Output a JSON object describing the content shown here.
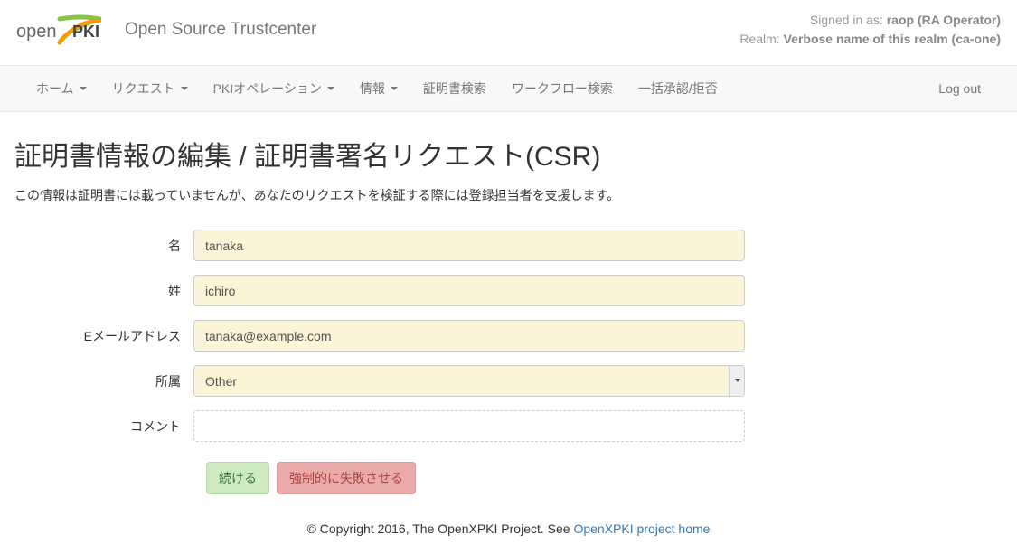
{
  "header": {
    "logo_text_open": "open",
    "logo_text_pki": "PKI",
    "brand_title": "Open Source Trustcenter",
    "signed_in_label": "Signed in as: ",
    "signed_in_user": "raop (RA Operator)",
    "realm_label": "Realm: ",
    "realm_value": "Verbose name of this realm (ca-one)"
  },
  "nav": {
    "home": "ホーム",
    "request": "リクエスト",
    "pki_ops": "PKIオペレーション",
    "info": "情報",
    "cert_search": "証明書検索",
    "workflow_search": "ワークフロー検索",
    "bulk_approve": "一括承認/拒否",
    "logout": "Log out"
  },
  "page": {
    "title": "証明書情報の編集 / 証明書署名リクエスト(CSR)",
    "subtitle": "この情報は証明書には載っていませんが、あなたのリクエストを検証する際には登録担当者を支援します。"
  },
  "form": {
    "first_name": {
      "label": "名",
      "value": "tanaka"
    },
    "last_name": {
      "label": "姓",
      "value": "ichiro"
    },
    "email": {
      "label": "Eメールアドレス",
      "value": "tanaka@example.com"
    },
    "affiliation": {
      "label": "所属",
      "value": "Other"
    },
    "comment": {
      "label": "コメント",
      "value": ""
    }
  },
  "buttons": {
    "continue": "続ける",
    "force_fail": "強制的に失敗させる"
  },
  "footer": {
    "copyright": "© Copyright 2016, The OpenXPKI Project. See ",
    "link_text": "OpenXPKI project home"
  }
}
